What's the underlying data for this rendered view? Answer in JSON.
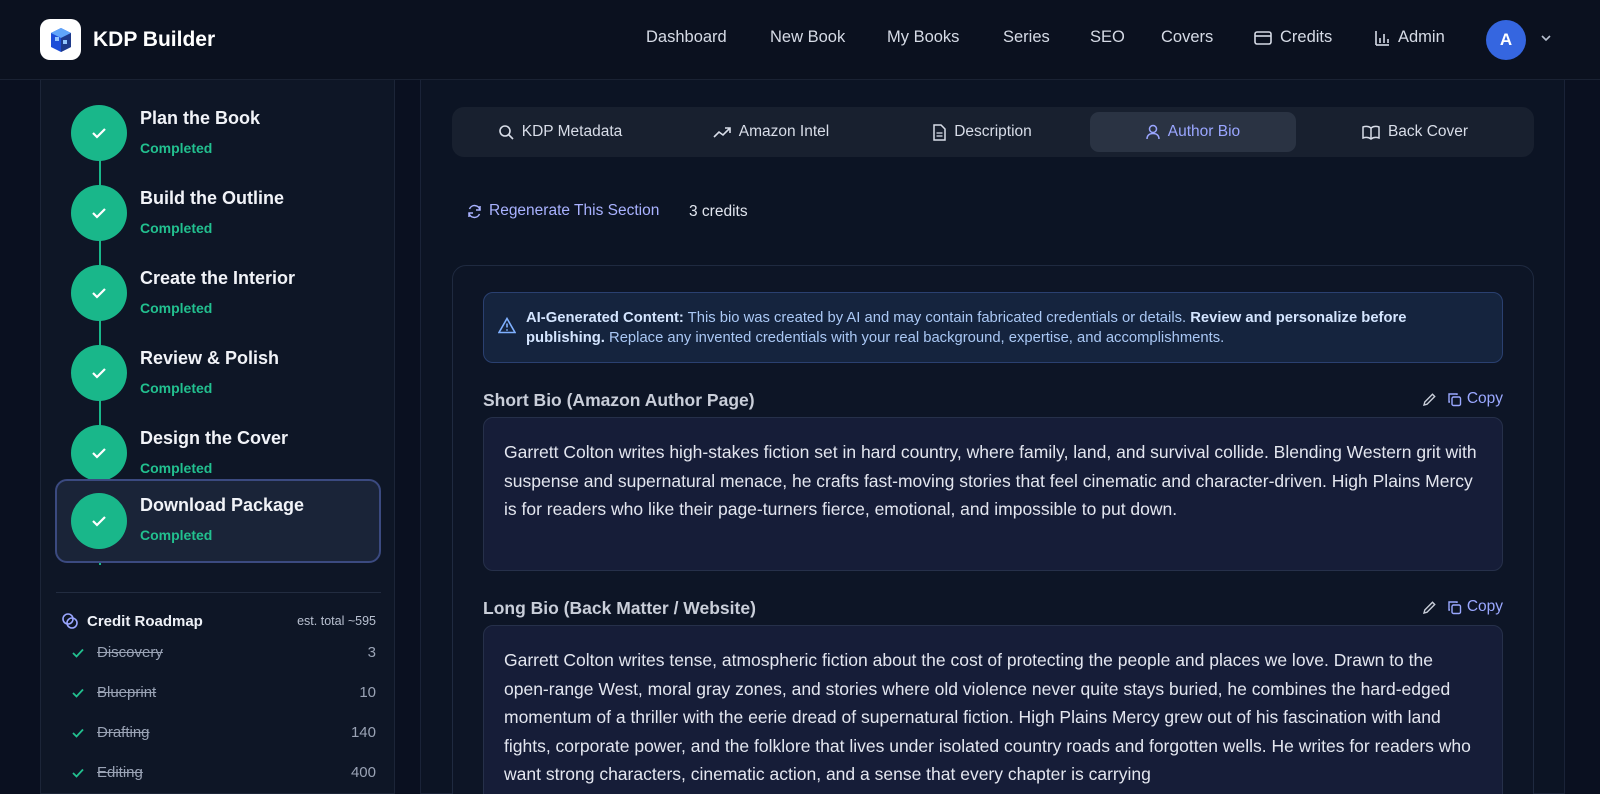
{
  "app": {
    "name": "KDP Builder"
  },
  "nav": {
    "items": [
      "Dashboard",
      "New Book",
      "My Books",
      "Series",
      "SEO",
      "Covers",
      "Credits",
      "Admin"
    ],
    "avatar_initial": "A"
  },
  "steps": [
    {
      "title": "Plan the Book",
      "status": "Completed"
    },
    {
      "title": "Build the Outline",
      "status": "Completed"
    },
    {
      "title": "Create the Interior",
      "status": "Completed"
    },
    {
      "title": "Review & Polish",
      "status": "Completed"
    },
    {
      "title": "Design the Cover",
      "status": "Completed"
    },
    {
      "title": "Download Package",
      "status": "Completed"
    }
  ],
  "roadmap": {
    "title": "Credit Roadmap",
    "total": "est. total ~595",
    "rows": [
      {
        "label": "Discovery",
        "value": "3"
      },
      {
        "label": "Blueprint",
        "value": "10"
      },
      {
        "label": "Drafting",
        "value": "140"
      },
      {
        "label": "Editing",
        "value": "400"
      }
    ]
  },
  "tabs": [
    "KDP Metadata",
    "Amazon Intel",
    "Description",
    "Author Bio",
    "Back Cover"
  ],
  "actions": {
    "regenerate": "Regenerate This Section",
    "credits": "3 credits",
    "copy": "Copy"
  },
  "notice": {
    "lead": "AI-Generated Content:",
    "text": " This bio was created by AI and may contain fabricated credentials or details. ",
    "bold": "Review and personalize before publishing.",
    "tail": " Replace any invented credentials with your real background, expertise, and accomplishments."
  },
  "short_bio": {
    "title": "Short Bio (Amazon Author Page)",
    "text": "Garrett Colton writes high-stakes fiction set in hard country, where family, land, and survival collide. Blending Western grit with suspense and supernatural menace, he crafts fast-moving stories that feel cinematic and character-driven. High Plains Mercy is for readers who like their page-turners fierce, emotional, and impossible to put down."
  },
  "long_bio": {
    "title": "Long Bio (Back Matter / Website)",
    "text": "Garrett Colton writes tense, atmospheric fiction about the cost of protecting the people and places we love. Drawn to the open-range West, moral gray zones, and stories where old violence never quite stays buried, he combines the hard-edged momentum of a thriller with the eerie dread of supernatural fiction. High Plains Mercy grew out of his fascination with land fights, corporate power, and the folklore that lives under isolated country roads and forgotten wells. He writes for readers who want strong characters, cinematic action, and a sense that every chapter is carrying"
  },
  "colors": {
    "accent": "#9aa6ff",
    "success": "#19b78a",
    "avatar": "#3566e0"
  }
}
